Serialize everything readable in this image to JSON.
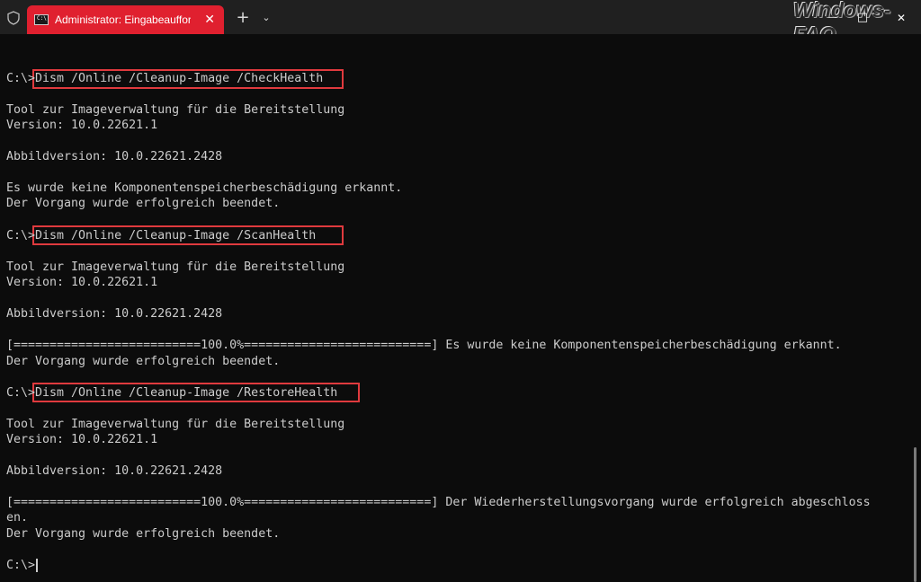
{
  "titlebar": {
    "tab_title": "Administrator: Eingabeaufforderung",
    "tab_icon_glyph": "C:\\",
    "close_tab": "✕",
    "new_tab": "+",
    "dropdown": "⌄",
    "watermark": "Windows-FAQ",
    "minimize": "—",
    "maximize": "□",
    "close_window": "✕"
  },
  "terminal": {
    "lines": [
      "C:\\>Dism /Online /Cleanup-Image /CheckHealth",
      "Tool zur Imageverwaltung für die Bereitstellung",
      "Version: 10.0.22621.1",
      "Abbildversion: 10.0.22621.2428",
      "Es wurde keine Komponentenspeicherbeschädigung erkannt.",
      "Der Vorgang wurde erfolgreich beendet.",
      "C:\\>Dism /Online /Cleanup-Image /ScanHealth",
      "Tool zur Imageverwaltung für die Bereitstellung",
      "Version: 10.0.22621.1",
      "Abbildversion: 10.0.22621.2428",
      "[==========================100.0%==========================] Es wurde keine Komponentenspeicherbeschädigung erkannt.",
      "Der Vorgang wurde erfolgreich beendet.",
      "C:\\>Dism /Online /Cleanup-Image /RestoreHealth",
      "Tool zur Imageverwaltung für die Bereitstellung",
      "Version: 10.0.22621.1",
      "Abbildversion: 10.0.22621.2428",
      "[==========================100.0%==========================] Der Wiederherstellungsvorgang wurde erfolgreich abgeschloss",
      "en.",
      "Der Vorgang wurde erfolgreich beendet.",
      "C:\\>"
    ]
  },
  "colors": {
    "tab_accent": "#e0202f",
    "highlight_border": "#e03a3e",
    "terminal_bg": "#0c0c0c",
    "terminal_text": "#cccccc"
  }
}
